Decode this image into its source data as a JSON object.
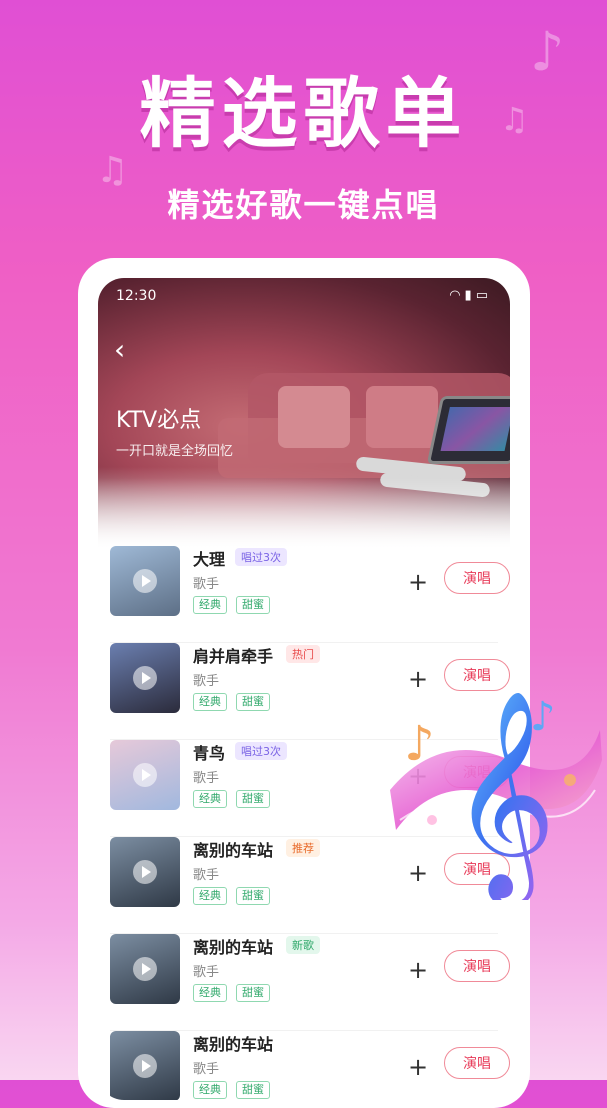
{
  "hero": {
    "title": "精选歌单",
    "subtitle": "精选好歌一键点唱"
  },
  "status_bar": {
    "time": "12:30"
  },
  "playlist": {
    "title": "KTV必点",
    "subtitle": "一开口就是全场回忆"
  },
  "actions": {
    "add": "+",
    "sing": "演唱"
  },
  "songs": [
    {
      "name": "大理",
      "badge": "唱过3次",
      "badge_type": "count",
      "artist": "歌手",
      "tags": [
        "经典",
        "甜蜜"
      ],
      "thumb_colors": [
        "#9fb9d6",
        "#5d6f86"
      ]
    },
    {
      "name": "肩并肩牵手",
      "badge": "热门",
      "badge_type": "hot",
      "artist": "歌手",
      "tags": [
        "经典",
        "甜蜜"
      ],
      "thumb_colors": [
        "#6b7fb0",
        "#2b2b3b"
      ]
    },
    {
      "name": "青鸟",
      "badge": "唱过3次",
      "badge_type": "count",
      "artist": "歌手",
      "tags": [
        "经典",
        "甜蜜"
      ],
      "thumb_colors": [
        "#e6c9d9",
        "#a1b8de"
      ]
    },
    {
      "name": "离别的车站",
      "badge": "推荐",
      "badge_type": "recommend",
      "artist": "歌手",
      "tags": [
        "经典",
        "甜蜜"
      ],
      "thumb_colors": [
        "#7c8ea2",
        "#2f3946"
      ]
    },
    {
      "name": "离别的车站",
      "badge": "新歌",
      "badge_type": "new",
      "artist": "歌手",
      "tags": [
        "经典",
        "甜蜜"
      ],
      "thumb_colors": [
        "#7c8ea2",
        "#2f3946"
      ]
    },
    {
      "name": "离别的车站",
      "badge": "",
      "badge_type": "none",
      "artist": "歌手",
      "tags": [
        "经典",
        "甜蜜"
      ],
      "thumb_colors": [
        "#7c8ea2",
        "#2f3946"
      ]
    }
  ],
  "colors": {
    "accent": "#e83c5a",
    "tag_green": "#2fa86a",
    "background_pink": "#ef5fc5"
  },
  "icons": [
    "back-arrow-icon",
    "wifi-icon",
    "signal-icon",
    "battery-icon",
    "play-icon",
    "plus-icon",
    "treble-clef-icon",
    "music-note-icon"
  ]
}
